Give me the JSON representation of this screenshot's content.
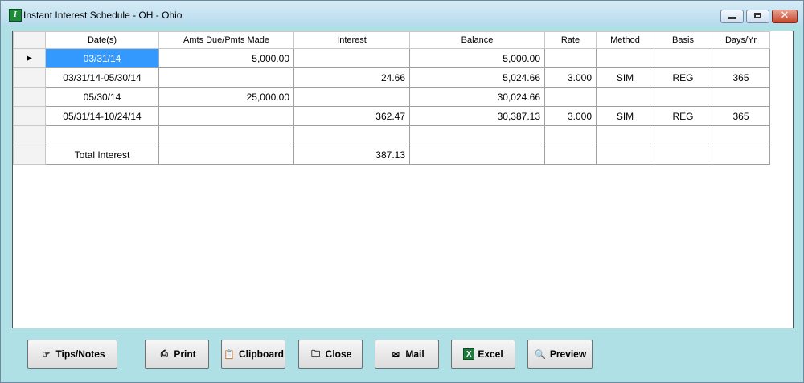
{
  "window": {
    "title": "Instant Interest Schedule - OH  - Ohio",
    "icon": "app-logo-icon",
    "controls": {
      "minimize": "minimize-icon",
      "maximize": "maximize-icon",
      "close": "close-icon"
    }
  },
  "table": {
    "columns": [
      "Date(s)",
      "Amts Due/Pmts Made",
      "Interest",
      "Balance",
      "Rate",
      "Method",
      "Basis",
      "Days/Yr"
    ],
    "rows": [
      {
        "date": "03/31/14",
        "amt": "5,000.00",
        "interest": "",
        "balance": "5,000.00",
        "rate": "",
        "method": "",
        "basis": "",
        "days": "",
        "current": true
      },
      {
        "date": "03/31/14-05/30/14",
        "amt": "",
        "interest": "24.66",
        "balance": "5,024.66",
        "rate": "3.000",
        "method": "SIM",
        "basis": "REG",
        "days": "365"
      },
      {
        "date": "05/30/14",
        "amt": "25,000.00",
        "interest": "",
        "balance": "30,024.66",
        "rate": "",
        "method": "",
        "basis": "",
        "days": ""
      },
      {
        "date": "05/31/14-10/24/14",
        "amt": "",
        "interest": "362.47",
        "balance": "30,387.13",
        "rate": "3.000",
        "method": "SIM",
        "basis": "REG",
        "days": "365"
      },
      {
        "date": "",
        "amt": "",
        "interest": "",
        "balance": "",
        "rate": "",
        "method": "",
        "basis": "",
        "days": ""
      },
      {
        "date": "Total Interest",
        "amt": "",
        "interest": "387.13",
        "balance": "",
        "rate": "",
        "method": "",
        "basis": "",
        "days": ""
      }
    ],
    "current_row_icon": "row-pointer-icon",
    "selection_color": "#3399ff"
  },
  "buttons": {
    "tips": {
      "label": "Tips/Notes",
      "icon": "pointing-hand-icon"
    },
    "print": {
      "label": "Print",
      "icon": "printer-icon"
    },
    "clipboard": {
      "label": "Clipboard",
      "icon": "clipboard-icon"
    },
    "close": {
      "label": "Close",
      "icon": "folder-exit-icon"
    },
    "mail": {
      "label": "Mail",
      "icon": "envelope-icon"
    },
    "excel": {
      "label": "Excel",
      "icon": "excel-icon"
    },
    "preview": {
      "label": "Preview",
      "icon": "magnifier-icon"
    }
  },
  "colors": {
    "background": "#aee0e6",
    "window_border": "#6b8aa0"
  }
}
